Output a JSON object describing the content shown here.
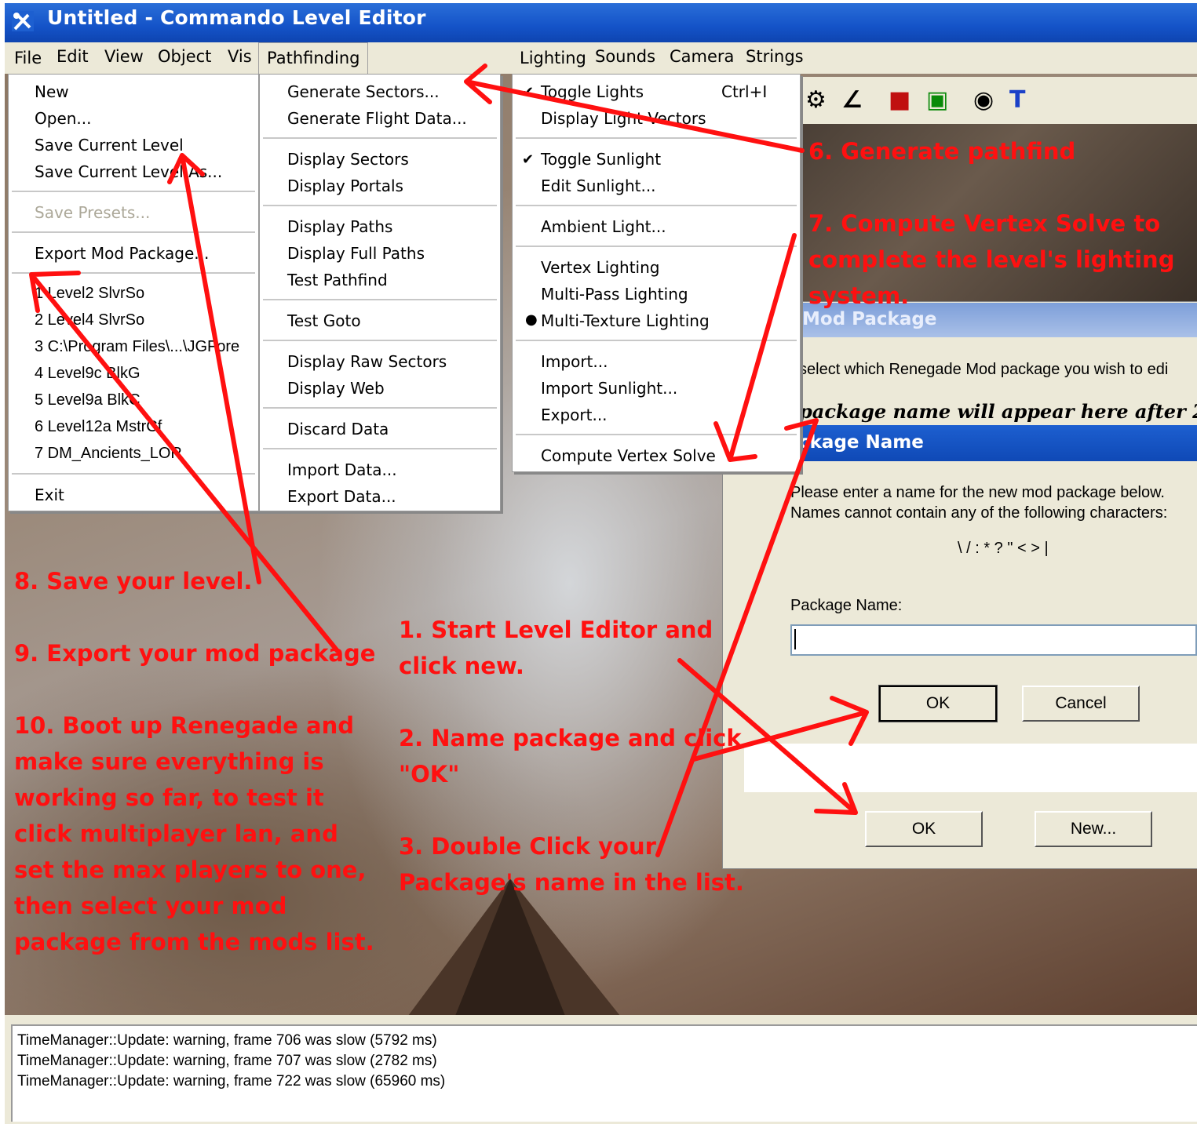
{
  "window": {
    "title": "Untitled - Commando Level Editor"
  },
  "menubar": {
    "items": [
      "File",
      "Edit",
      "View",
      "Object",
      "Vis",
      "Pathfinding",
      "Lighting",
      "Sounds",
      "Camera",
      "Strings"
    ]
  },
  "file_menu": {
    "items": [
      "New",
      "Open...",
      "Save Current Level",
      "Save Current Level As...",
      "Save Presets...",
      "Export Mod Package...",
      "1 Level2 SlvrSo",
      "2 Level4 SlvrSo",
      "3 C:\\Program Files\\...\\JGFore",
      "4 Level9c BlkG",
      "5 Level9a BlkC",
      "6 Level12a MstrCf",
      "7 DM_Ancients_LOR",
      "Exit"
    ]
  },
  "pathfinding_menu": {
    "items": [
      "Generate Sectors...",
      "Generate Flight Data...",
      "Display Sectors",
      "Display Portals",
      "Display Paths",
      "Display Full Paths",
      "Test Pathfind",
      "Test Goto",
      "Display Raw Sectors",
      "Display Web",
      "Discard Data",
      "Import Data...",
      "Export Data..."
    ]
  },
  "lighting_menu": {
    "items": [
      "Toggle Lights",
      "Display Light Vectors",
      "Toggle Sunlight",
      "Edit Sunlight...",
      "Ambient Light...",
      "Vertex Lighting",
      "Multi-Pass Lighting",
      "Multi-Texture Lighting",
      "Import...",
      "Import Sunlight...",
      "Export...",
      "Compute Vertex Solve"
    ],
    "toggle_lights_shortcut": "Ctrl+I"
  },
  "mod_package": {
    "title": "Mod Package",
    "select_text": "select which Renegade Mod package you wish to edi",
    "hint": "package name will appear here after 2",
    "ok_label": "OK",
    "new_label": "New..."
  },
  "package_name_dialog": {
    "title": "ckage Name",
    "line1": "Please enter a name for the new mod package below.",
    "line2": "Names cannot contain any of the following characters:",
    "invalid_chars": "\\ / : * ? \" < > |",
    "field_label": "Package Name:",
    "field_value": "",
    "ok_label": "OK",
    "cancel_label": "Cancel"
  },
  "log": {
    "lines": [
      "TimeManager::Update: warning, frame 706 was slow (5792 ms)",
      "TimeManager::Update: warning, frame 707 was slow (2782 ms)",
      "TimeManager::Update: warning, frame 722 was slow (65960 ms)"
    ]
  },
  "annotations": {
    "step1": [
      "1. Start Level Editor and",
      "click new."
    ],
    "step2": [
      "2. Name package and click",
      "\"OK\""
    ],
    "step3": [
      "3. Double Click your",
      "Package's name in the list."
    ],
    "step6": [
      "6. Generate pathfind"
    ],
    "step7": [
      "7. Compute Vertex Solve to",
      "complete the level's lighting",
      "system."
    ],
    "step8": [
      "8. Save your level."
    ],
    "step9": [
      "9. Export your mod package"
    ],
    "step10": [
      "10. Boot up Renegade and",
      "make sure everything is",
      "working so far, to test it",
      "click multiplayer lan, and",
      "set the max players to one,",
      "then select your mod",
      "package from the mods list."
    ]
  },
  "colors": {
    "annotation": "#ff1010",
    "titlebar": "#1453c8",
    "menu_bg": "#ece9d8"
  },
  "icons": [
    "tools-icon",
    "vehicle-icon",
    "path-icon",
    "cube-icon",
    "color-blocks-icon",
    "eye-icon",
    "text-icon"
  ]
}
